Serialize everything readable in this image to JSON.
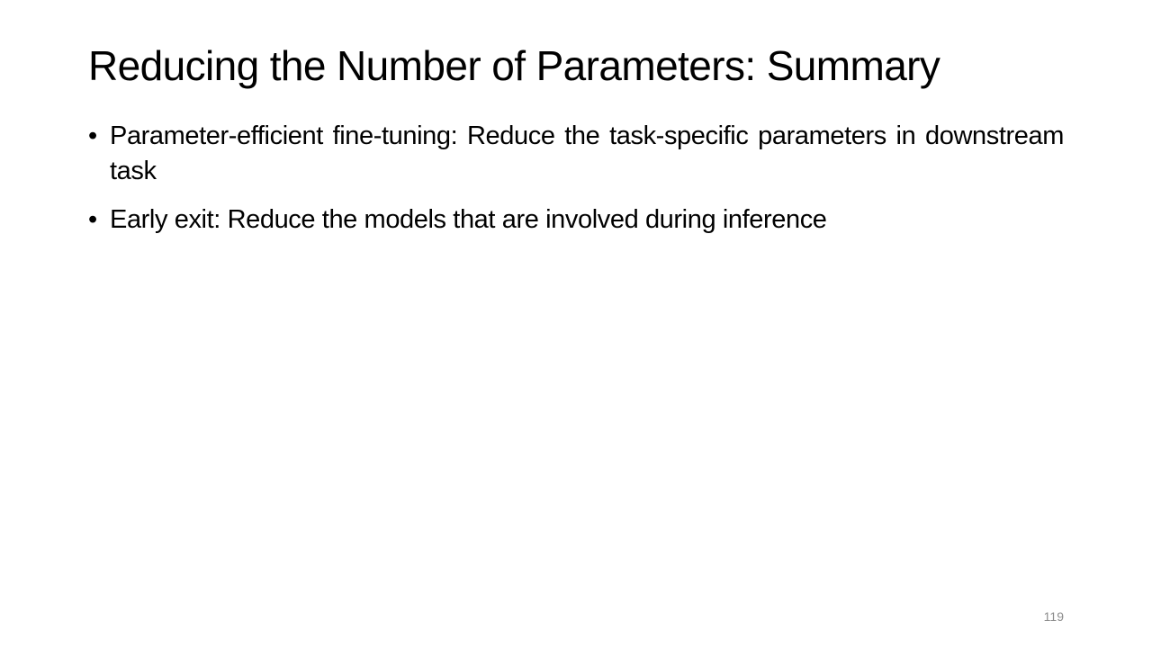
{
  "slide": {
    "title": "Reducing the Number of Parameters: Summary",
    "bullets": [
      {
        "marker": "•",
        "text": "Parameter-efficient fine-tuning: Reduce the task-specific parameters in downstream task"
      },
      {
        "marker": "•",
        "text": "Early exit: Reduce the models that are involved during inference"
      }
    ],
    "page_number": "119"
  },
  "colors": {
    "background": "#ffffff",
    "text": "#000000",
    "page_number": "#8c8c8c"
  }
}
